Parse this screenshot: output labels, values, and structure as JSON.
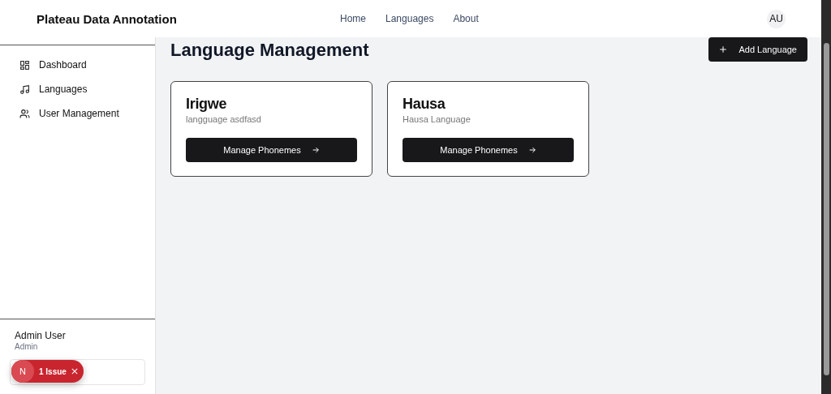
{
  "header": {
    "title": "Plateau Data Annotation",
    "nav": [
      {
        "label": "Home"
      },
      {
        "label": "Languages"
      },
      {
        "label": "About"
      }
    ],
    "avatar": "AU"
  },
  "sidebar": {
    "items": [
      {
        "label": "Dashboard",
        "kind": "dashboard"
      },
      {
        "label": "Languages",
        "kind": "music"
      },
      {
        "label": "User Management",
        "kind": "users"
      }
    ],
    "user": {
      "name": "Admin User",
      "role": "Admin"
    }
  },
  "main": {
    "title": "Language Management",
    "add_button": "Add Language",
    "languages": [
      {
        "name": "Irigwe",
        "description": "langguage asdfasd",
        "action": "Manage Phonemes"
      },
      {
        "name": "Hausa",
        "description": "Hausa Language",
        "action": "Manage Phonemes"
      }
    ]
  },
  "dev_overlay": {
    "logo": "N",
    "label": "1 Issue"
  }
}
